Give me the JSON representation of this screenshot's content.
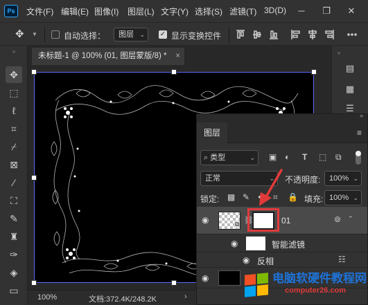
{
  "app": {
    "logo": "Ps",
    "menu": [
      "文件(F)",
      "编辑(E)",
      "图像(I)",
      "图层(L)",
      "文字(Y)",
      "选择(S)",
      "滤镜(T)",
      "3D(D)"
    ],
    "window_controls": [
      "minimize-icon",
      "restore-icon",
      "close-icon"
    ]
  },
  "options_bar": {
    "tool_icon": "move-icon",
    "auto_select_label": "自动选择：",
    "auto_select_checked": false,
    "auto_select_target": "图层",
    "show_transform_label": "显示变换控件",
    "show_transform_checked": true
  },
  "document": {
    "tab_title": "未标题-1 @ 100% (01, 图层蒙版/8) *",
    "tab_close": "×"
  },
  "status_bar": {
    "zoom": "100%",
    "doc_info": "文档:372.4K/248.2K",
    "arrow": "›"
  },
  "layers_panel": {
    "tab_label": "图层",
    "filter_kind": "类型",
    "blend_mode": "正常",
    "opacity_label": "不透明度:",
    "opacity_value": "100%",
    "lock_label": "锁定:",
    "fill_label": "填充:",
    "fill_value": "100%",
    "layers": [
      {
        "name": "01",
        "visible": true,
        "selected": true
      },
      {
        "name": "智能滤镜",
        "visible": true,
        "selected": false
      },
      {
        "name": "反相",
        "visible": true,
        "selected": false
      }
    ]
  },
  "watermark": {
    "title": "电脑软硬件教程网",
    "url": "computer26.com"
  },
  "colors": {
    "selection_border": "#5a6bff",
    "annotation_red": "#e23a3a",
    "watermark_blue": "#1e73d8"
  }
}
